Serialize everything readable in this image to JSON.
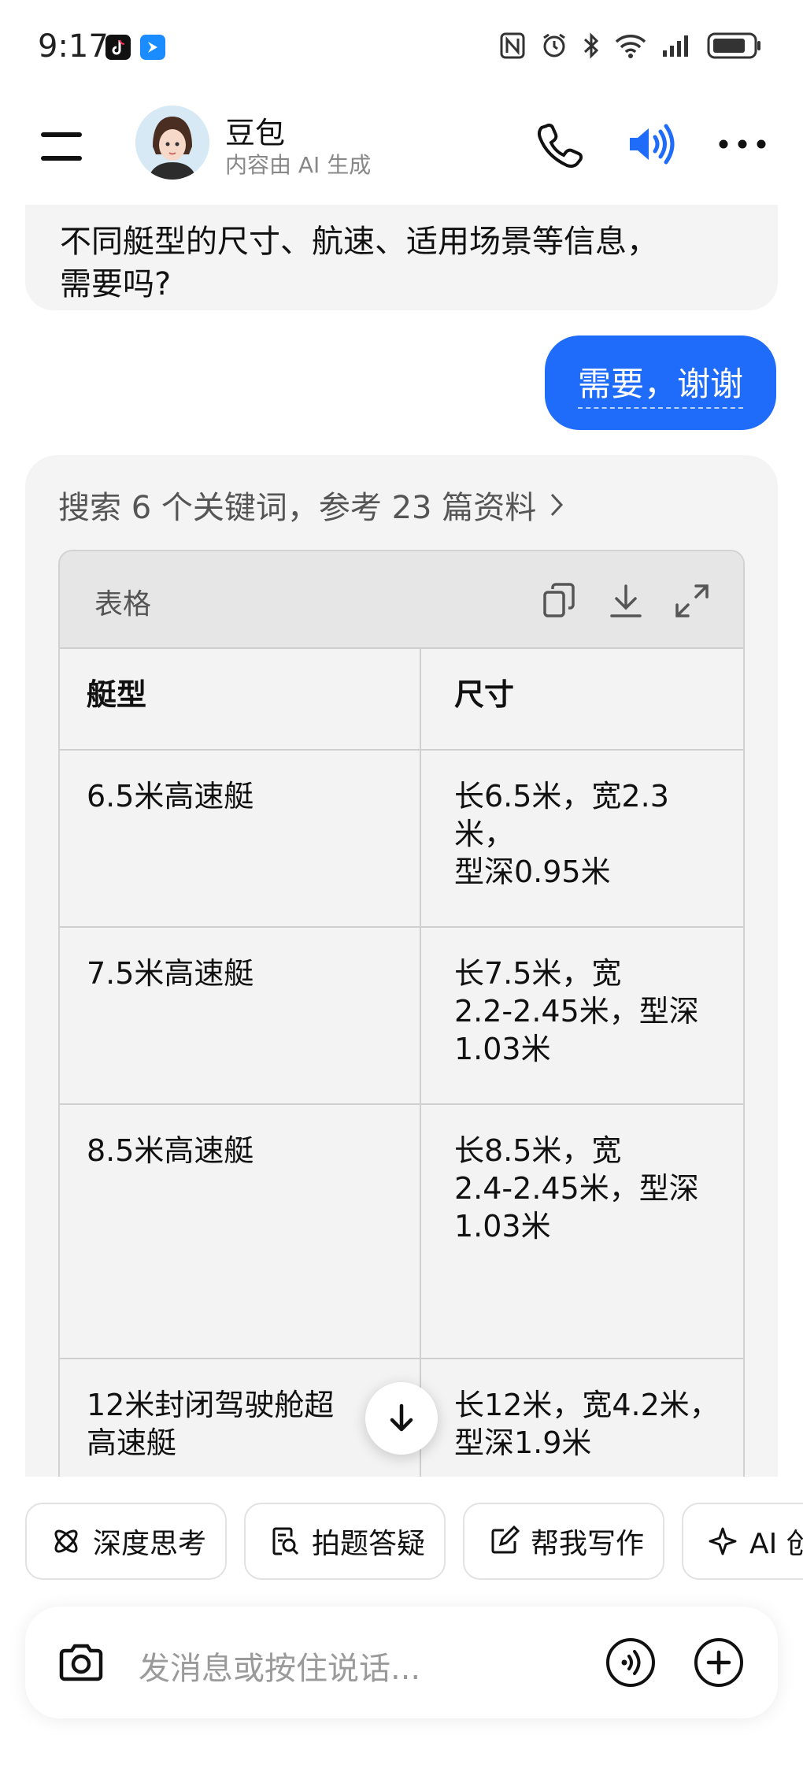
{
  "status": {
    "time": "9:17"
  },
  "header": {
    "title": "豆包",
    "subtitle": "内容由 AI 生成"
  },
  "chat": {
    "previous_lines": [
      "不同艇型的尺寸、航速、适用场景等信息，",
      "需要吗?"
    ],
    "user_message": "需要，谢谢",
    "ai": {
      "reference_text": "搜索 6 个关键词，参考 23 篇资料",
      "table": {
        "label": "表格",
        "headers": [
          "艇型",
          "尺寸"
        ],
        "rows": [
          {
            "type": "6.5米高速艇",
            "size": [
              "长6.5米，宽2.3米，",
              "型深0.95米"
            ]
          },
          {
            "type": "7.5米高速艇",
            "size": [
              "长7.5米，宽",
              "2.2-2.45米，型深",
              "1.03米"
            ]
          },
          {
            "type": "8.5米高速艇",
            "size": [
              "长8.5米，宽",
              "2.4-2.45米，型深",
              "1.03米"
            ]
          },
          {
            "type": [
              "12米封闭驾驶舱超",
              "高速艇"
            ],
            "size": [
              "长12米，宽4.2米，",
              "型深1.9米"
            ]
          }
        ]
      }
    }
  },
  "chips": [
    "深度思考",
    "拍题答疑",
    "帮我写作",
    "AI 创"
  ],
  "input": {
    "placeholder": "发消息或按住说话..."
  },
  "colors": {
    "accent": "#1f6bfa",
    "bubble": "#f4f4f4"
  }
}
